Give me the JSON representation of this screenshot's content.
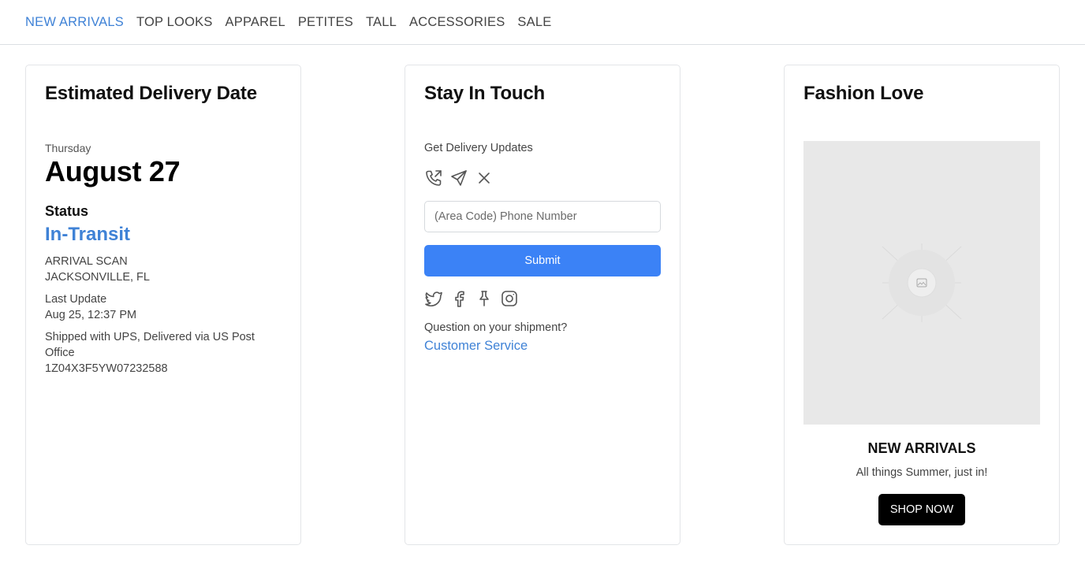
{
  "nav": {
    "items": [
      {
        "label": "NEW ARRIVALS",
        "active": true
      },
      {
        "label": "TOP LOOKS",
        "active": false
      },
      {
        "label": "APPAREL",
        "active": false
      },
      {
        "label": "PETITES",
        "active": false
      },
      {
        "label": "TALL",
        "active": false
      },
      {
        "label": "ACCESSORIES",
        "active": false
      },
      {
        "label": "SALE",
        "active": false
      }
    ]
  },
  "delivery": {
    "title": "Estimated Delivery Date",
    "day": "Thursday",
    "date": "August 27",
    "status_label": "Status",
    "status_value": "In-Transit",
    "scan_line1": "ARRIVAL SCAN",
    "scan_line2": "JACKSONVILLE, FL",
    "update_label": "Last Update",
    "update_value": "Aug 25, 12:37 PM",
    "shipping_note": "Shipped with UPS, Delivered via US Post Office",
    "tracking_number": "1Z04X3F5YW07232588"
  },
  "touch": {
    "title": "Stay In Touch",
    "updates_label": "Get Delivery Updates",
    "contact_icons": [
      "phone-call-icon",
      "send-icon",
      "close-icon"
    ],
    "phone_placeholder": "(Area Code) Phone Number",
    "submit_label": "Submit",
    "social_icons": [
      "twitter-icon",
      "facebook-icon",
      "pinterest-icon",
      "instagram-icon"
    ],
    "question": "Question on your shipment?",
    "cs_link": "Customer Service"
  },
  "fashion": {
    "title": "Fashion Love",
    "image_icon": "image-placeholder-icon",
    "promo_title": "NEW ARRIVALS",
    "promo_sub": "All things Summer, just in!",
    "shop_label": "SHOP NOW"
  },
  "colors": {
    "accent": "#3f82d6",
    "button_blue": "#3b82f6",
    "image_bg": "#e8e8e8"
  }
}
